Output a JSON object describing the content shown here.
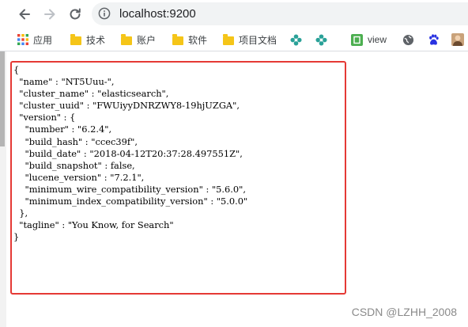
{
  "browser": {
    "url": "localhost:9200"
  },
  "bookmarks": [
    {
      "label": "应用",
      "icon": "apps-grid-icon"
    },
    {
      "label": "技术",
      "icon": "folder-icon"
    },
    {
      "label": "账户",
      "icon": "folder-icon"
    },
    {
      "label": "软件",
      "icon": "folder-icon"
    },
    {
      "label": "项目文档",
      "icon": "folder-icon"
    },
    {
      "label": "",
      "icon": "green-flower-icon"
    },
    {
      "label": "",
      "icon": "green-flower-icon"
    },
    {
      "label": "view",
      "icon": "green-square-icon"
    },
    {
      "label": "",
      "icon": "globe-icon"
    },
    {
      "label": "",
      "icon": "baidu-paw-icon"
    },
    {
      "label": "",
      "icon": "avatar-icon"
    }
  ],
  "response": {
    "lines": [
      "{",
      "  \"name\" : \"NT5Uuu-\",",
      "  \"cluster_name\" : \"elasticsearch\",",
      "  \"cluster_uuid\" : \"FWUiyyDNRZWY8-19hjUZGA\",",
      "  \"version\" : {",
      "    \"number\" : \"6.2.4\",",
      "    \"build_hash\" : \"ccec39f\",",
      "    \"build_date\" : \"2018-04-12T20:37:28.497551Z\",",
      "    \"build_snapshot\" : false,",
      "    \"lucene_version\" : \"7.2.1\",",
      "    \"minimum_wire_compatibility_version\" : \"5.6.0\",",
      "    \"minimum_index_compatibility_version\" : \"5.0.0\"",
      "  },",
      "  \"tagline\" : \"You Know, for Search\"",
      "}"
    ]
  },
  "watermark": "CSDN @LZHH_2008",
  "colors": {
    "highlight": "#e53935",
    "folder": "#f5c518",
    "flower": "#2aa198"
  }
}
